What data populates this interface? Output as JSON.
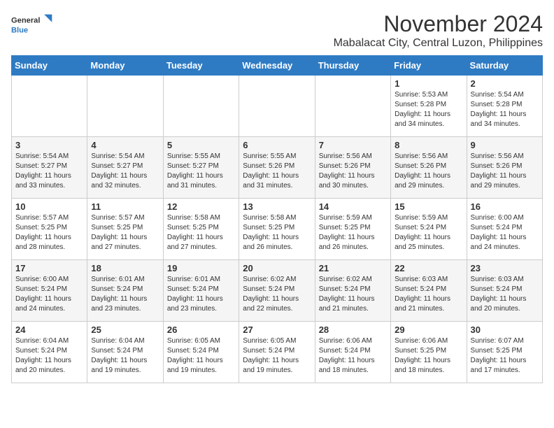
{
  "logo": {
    "line1": "General",
    "line2": "Blue"
  },
  "title": "November 2024",
  "subtitle": "Mabalacat City, Central Luzon, Philippines",
  "headers": [
    "Sunday",
    "Monday",
    "Tuesday",
    "Wednesday",
    "Thursday",
    "Friday",
    "Saturday"
  ],
  "weeks": [
    [
      {
        "day": "",
        "info": ""
      },
      {
        "day": "",
        "info": ""
      },
      {
        "day": "",
        "info": ""
      },
      {
        "day": "",
        "info": ""
      },
      {
        "day": "",
        "info": ""
      },
      {
        "day": "1",
        "info": "Sunrise: 5:53 AM\nSunset: 5:28 PM\nDaylight: 11 hours\nand 34 minutes."
      },
      {
        "day": "2",
        "info": "Sunrise: 5:54 AM\nSunset: 5:28 PM\nDaylight: 11 hours\nand 34 minutes."
      }
    ],
    [
      {
        "day": "3",
        "info": "Sunrise: 5:54 AM\nSunset: 5:27 PM\nDaylight: 11 hours\nand 33 minutes."
      },
      {
        "day": "4",
        "info": "Sunrise: 5:54 AM\nSunset: 5:27 PM\nDaylight: 11 hours\nand 32 minutes."
      },
      {
        "day": "5",
        "info": "Sunrise: 5:55 AM\nSunset: 5:27 PM\nDaylight: 11 hours\nand 31 minutes."
      },
      {
        "day": "6",
        "info": "Sunrise: 5:55 AM\nSunset: 5:26 PM\nDaylight: 11 hours\nand 31 minutes."
      },
      {
        "day": "7",
        "info": "Sunrise: 5:56 AM\nSunset: 5:26 PM\nDaylight: 11 hours\nand 30 minutes."
      },
      {
        "day": "8",
        "info": "Sunrise: 5:56 AM\nSunset: 5:26 PM\nDaylight: 11 hours\nand 29 minutes."
      },
      {
        "day": "9",
        "info": "Sunrise: 5:56 AM\nSunset: 5:26 PM\nDaylight: 11 hours\nand 29 minutes."
      }
    ],
    [
      {
        "day": "10",
        "info": "Sunrise: 5:57 AM\nSunset: 5:25 PM\nDaylight: 11 hours\nand 28 minutes."
      },
      {
        "day": "11",
        "info": "Sunrise: 5:57 AM\nSunset: 5:25 PM\nDaylight: 11 hours\nand 27 minutes."
      },
      {
        "day": "12",
        "info": "Sunrise: 5:58 AM\nSunset: 5:25 PM\nDaylight: 11 hours\nand 27 minutes."
      },
      {
        "day": "13",
        "info": "Sunrise: 5:58 AM\nSunset: 5:25 PM\nDaylight: 11 hours\nand 26 minutes."
      },
      {
        "day": "14",
        "info": "Sunrise: 5:59 AM\nSunset: 5:25 PM\nDaylight: 11 hours\nand 26 minutes."
      },
      {
        "day": "15",
        "info": "Sunrise: 5:59 AM\nSunset: 5:24 PM\nDaylight: 11 hours\nand 25 minutes."
      },
      {
        "day": "16",
        "info": "Sunrise: 6:00 AM\nSunset: 5:24 PM\nDaylight: 11 hours\nand 24 minutes."
      }
    ],
    [
      {
        "day": "17",
        "info": "Sunrise: 6:00 AM\nSunset: 5:24 PM\nDaylight: 11 hours\nand 24 minutes."
      },
      {
        "day": "18",
        "info": "Sunrise: 6:01 AM\nSunset: 5:24 PM\nDaylight: 11 hours\nand 23 minutes."
      },
      {
        "day": "19",
        "info": "Sunrise: 6:01 AM\nSunset: 5:24 PM\nDaylight: 11 hours\nand 23 minutes."
      },
      {
        "day": "20",
        "info": "Sunrise: 6:02 AM\nSunset: 5:24 PM\nDaylight: 11 hours\nand 22 minutes."
      },
      {
        "day": "21",
        "info": "Sunrise: 6:02 AM\nSunset: 5:24 PM\nDaylight: 11 hours\nand 21 minutes."
      },
      {
        "day": "22",
        "info": "Sunrise: 6:03 AM\nSunset: 5:24 PM\nDaylight: 11 hours\nand 21 minutes."
      },
      {
        "day": "23",
        "info": "Sunrise: 6:03 AM\nSunset: 5:24 PM\nDaylight: 11 hours\nand 20 minutes."
      }
    ],
    [
      {
        "day": "24",
        "info": "Sunrise: 6:04 AM\nSunset: 5:24 PM\nDaylight: 11 hours\nand 20 minutes."
      },
      {
        "day": "25",
        "info": "Sunrise: 6:04 AM\nSunset: 5:24 PM\nDaylight: 11 hours\nand 19 minutes."
      },
      {
        "day": "26",
        "info": "Sunrise: 6:05 AM\nSunset: 5:24 PM\nDaylight: 11 hours\nand 19 minutes."
      },
      {
        "day": "27",
        "info": "Sunrise: 6:05 AM\nSunset: 5:24 PM\nDaylight: 11 hours\nand 19 minutes."
      },
      {
        "day": "28",
        "info": "Sunrise: 6:06 AM\nSunset: 5:24 PM\nDaylight: 11 hours\nand 18 minutes."
      },
      {
        "day": "29",
        "info": "Sunrise: 6:06 AM\nSunset: 5:25 PM\nDaylight: 11 hours\nand 18 minutes."
      },
      {
        "day": "30",
        "info": "Sunrise: 6:07 AM\nSunset: 5:25 PM\nDaylight: 11 hours\nand 17 minutes."
      }
    ]
  ]
}
